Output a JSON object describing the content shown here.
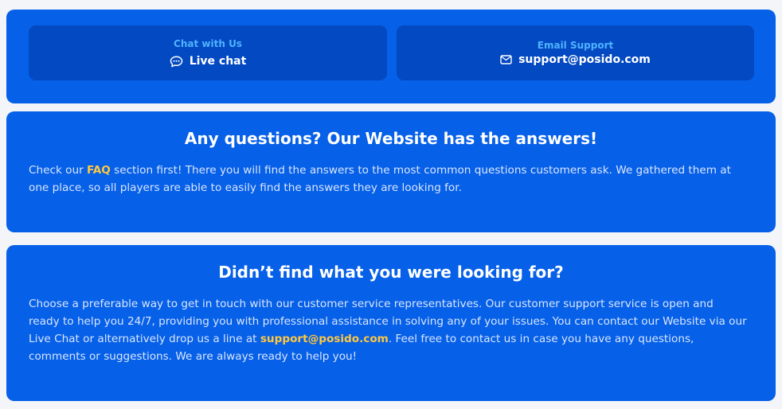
{
  "contact": {
    "chat": {
      "caption": "Chat with Us",
      "label": "Live chat",
      "icon": "chat-bubble-icon"
    },
    "email": {
      "caption": "Email Support",
      "label": "support@posido.com",
      "icon": "envelope-icon"
    }
  },
  "faq": {
    "heading": "Any questions? Our Website has the answers!",
    "text_before": "Check our ",
    "link": "FAQ",
    "text_after": " section first! There you will find the answers to the most common questions customers ask. We gathered them at one place, so all players are able to easily find the answers they are looking for."
  },
  "help": {
    "heading": "Didn’t find what you were looking for?",
    "text_before": "Choose a preferable way to get in touch with our customer service representatives. Our customer support service is open and ready to help you 24/7, providing you with professional assistance in solving any of your issues. You can contact our Website via our Live Chat or alternatively drop us a line at ",
    "email": "support@posido.com",
    "text_after": ". Feel free to contact us in case you have any questions, comments or suggestions. We are always ready to help you!"
  },
  "colors": {
    "panel": "#0660e8",
    "card": "#0349c2",
    "caption": "#4fb3ff",
    "highlight": "#ffc840"
  }
}
